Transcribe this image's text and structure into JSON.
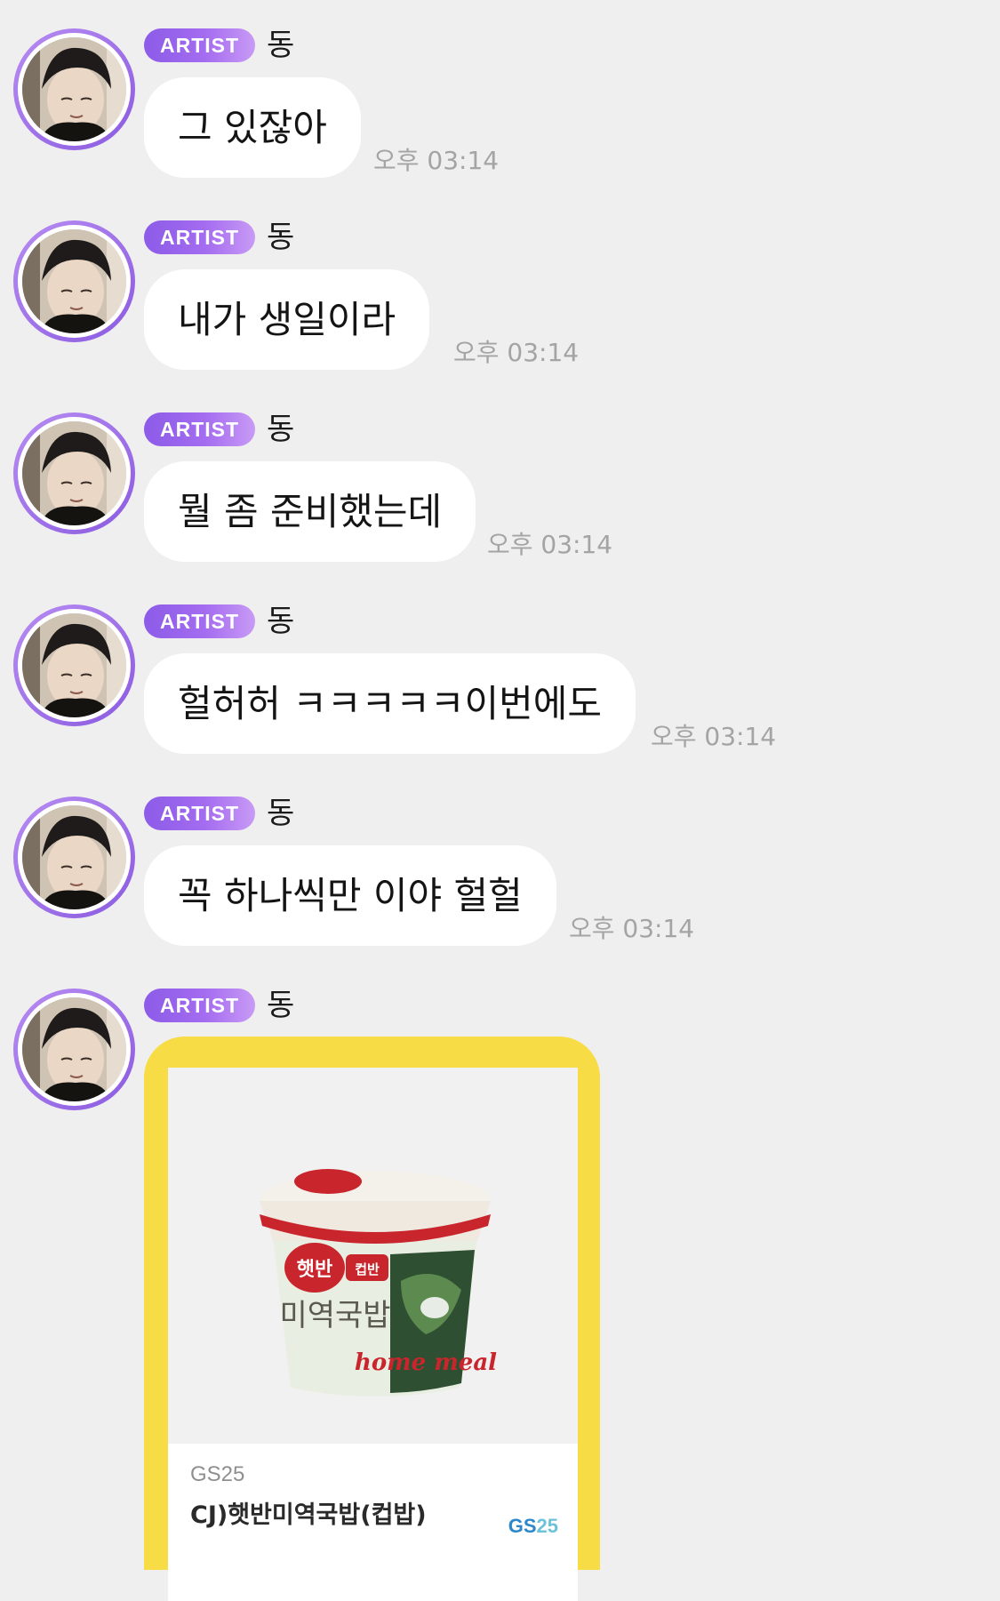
{
  "messages": [
    {
      "badge": "ARTIST",
      "sender": "동",
      "text": "그 있잖아",
      "time": "오후 03:14"
    },
    {
      "badge": "ARTIST",
      "sender": "동",
      "text": "내가 생일이라",
      "time": "오후 03:14"
    },
    {
      "badge": "ARTIST",
      "sender": "동",
      "text": "뭘 좀 준비했는데",
      "time": "오후 03:14"
    },
    {
      "badge": "ARTIST",
      "sender": "동",
      "text": "헐허허 ㅋㅋㅋㅋㅋ이번에도",
      "time": "오후 03:14"
    },
    {
      "badge": "ARTIST",
      "sender": "동",
      "text": "꼭 하나씩만 이야 헐헐",
      "time": "오후 03:14"
    }
  ],
  "gift_message": {
    "badge": "ARTIST",
    "sender": "동",
    "card": {
      "store": "GS25",
      "product": "CJ)햇반미역국밥(컵밥)",
      "logo_text": "GS",
      "logo_num": "25",
      "image_labels": {
        "brand": "햇반",
        "sub": "컵반",
        "name": "미역국밥",
        "tag": "home meal"
      }
    }
  },
  "colors": {
    "background": "#efefef",
    "badge": "#9a63ec",
    "bubble": "#ffffff",
    "card_frame": "#f7dc46",
    "time": "#a4a4a4"
  }
}
